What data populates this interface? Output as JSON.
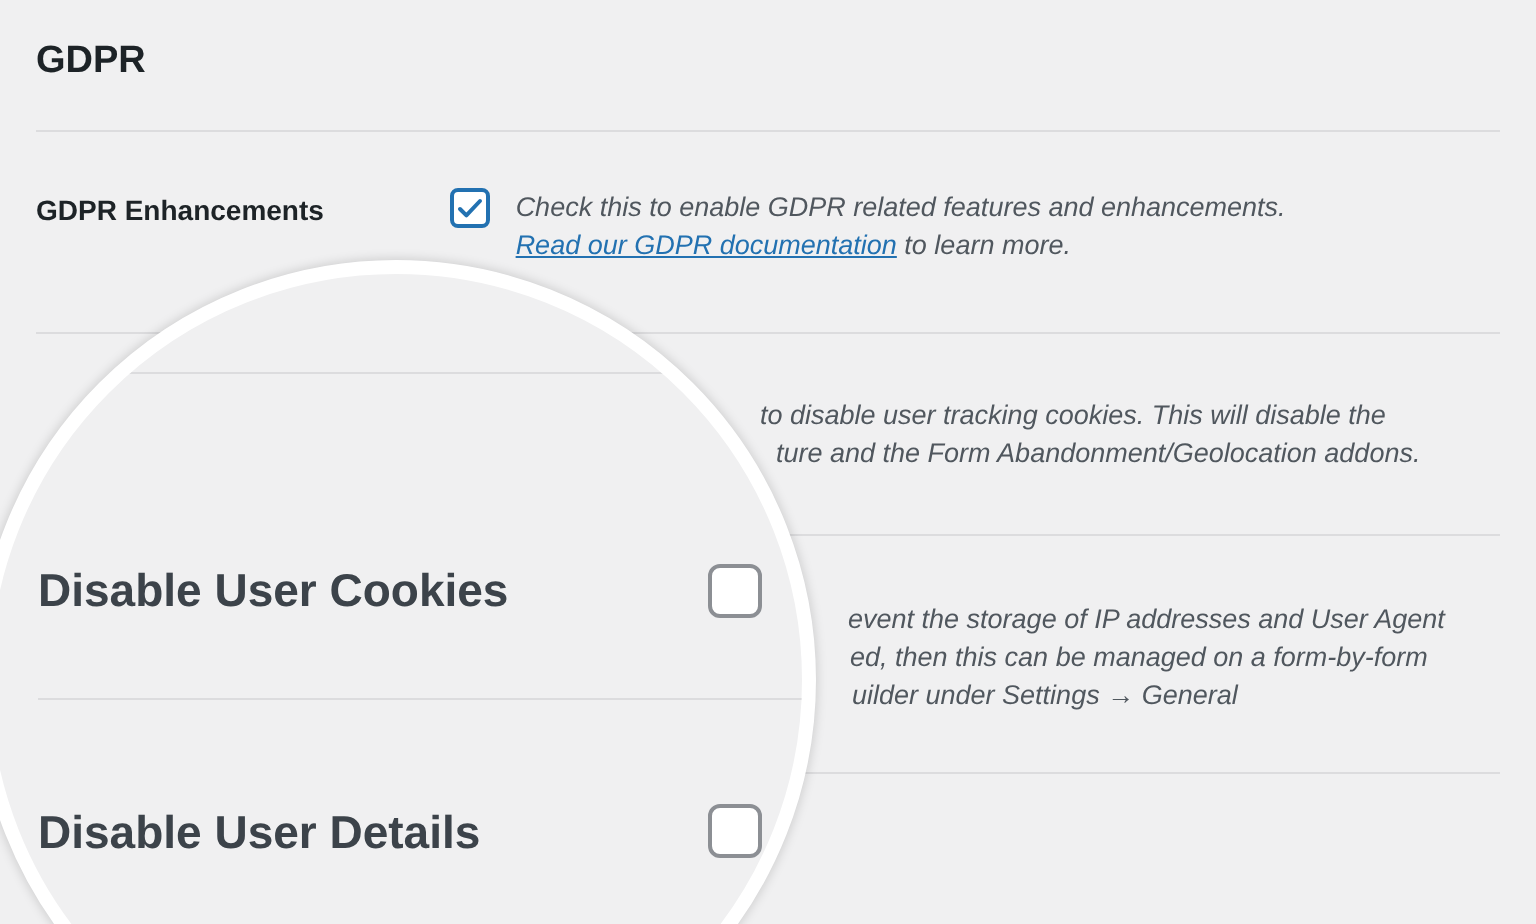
{
  "section": {
    "title": "GDPR"
  },
  "settings": [
    {
      "label": "GDPR Enhancements",
      "checked": true,
      "description_before": "Check this to enable GDPR related features and enhancements.",
      "link": "Read our GDPR documentation",
      "description_after": "to learn more."
    }
  ],
  "partially_hidden_settings": [
    {
      "description_lines": [
        "to disable user tracking cookies. This will disable the",
        "ture and the Form Abandonment/Geolocation addons."
      ]
    },
    {
      "description_lines": [
        "event the storage of IP addresses and User Agent",
        "ed, then this can be managed on a form-by-form",
        "uilder under Settings → General"
      ]
    }
  ],
  "magnifier": {
    "settings": [
      {
        "label": "Disable User Cookies",
        "checked": false
      },
      {
        "label": "Disable User Details",
        "checked": false
      }
    ]
  }
}
